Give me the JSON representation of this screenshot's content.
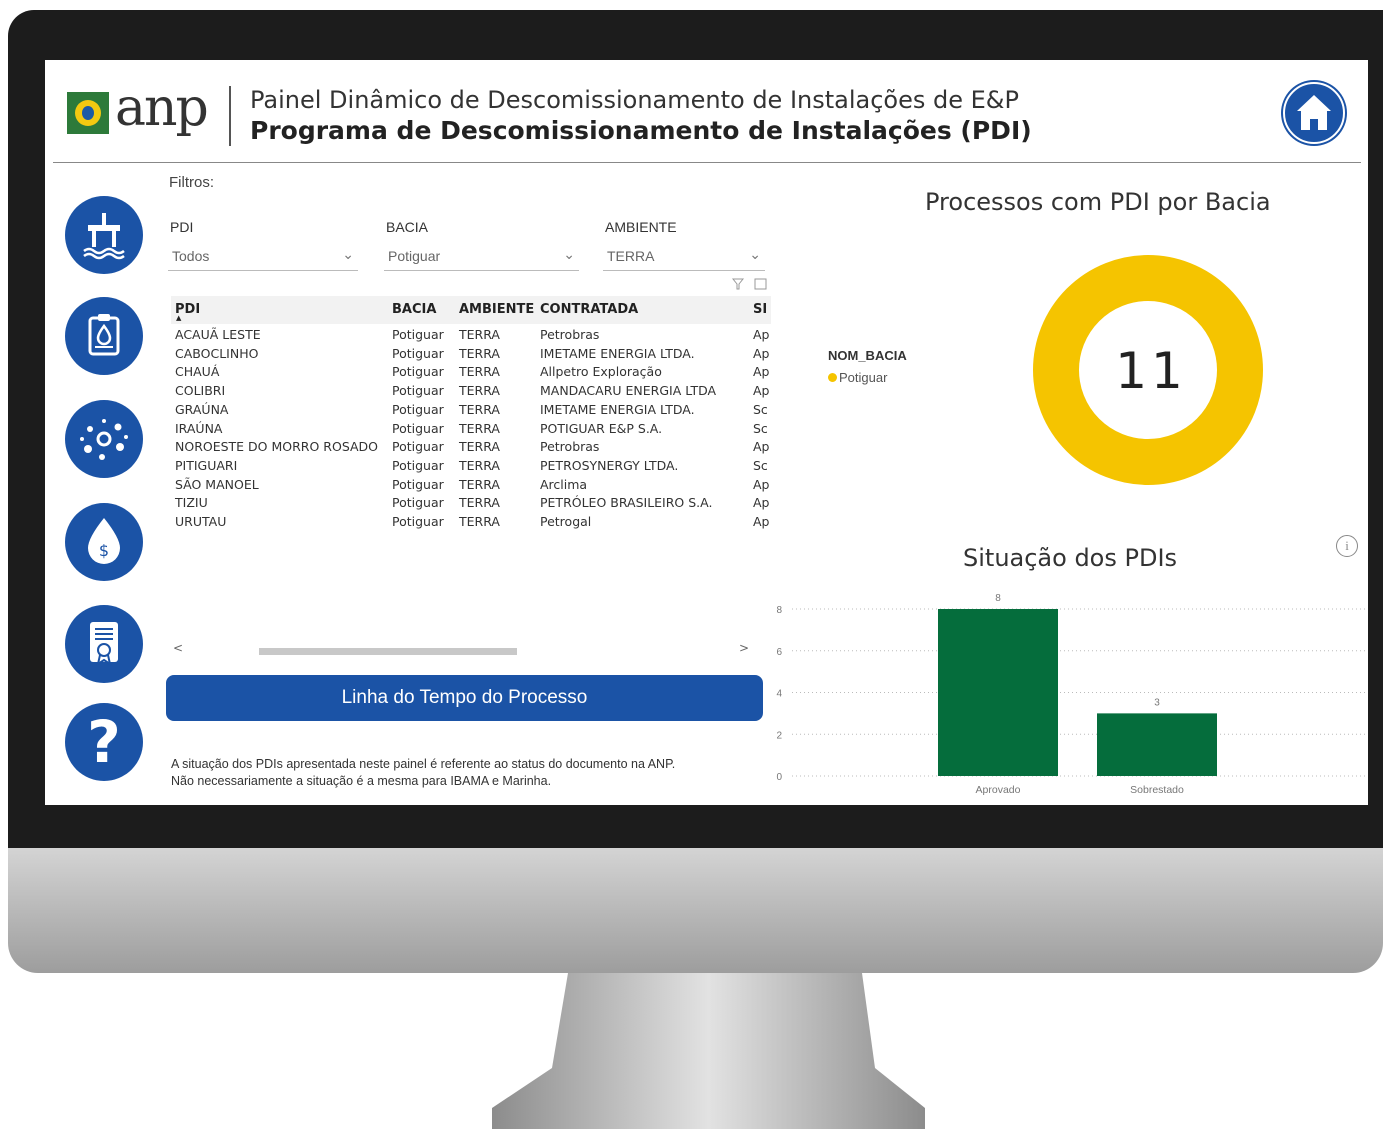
{
  "header": {
    "logo_text": "anp",
    "subtitle": "Painel Dinâmico de Descomissionamento de Instalações de E&P",
    "title": "Programa de Descomissionamento de Instalações (PDI)"
  },
  "nav": {
    "icons": [
      "platform-icon",
      "clipboard-drop-icon",
      "particles-icon",
      "money-drop-icon",
      "certificate-icon",
      "question-icon"
    ],
    "help_glyph": "?"
  },
  "filters": {
    "label": "Filtros:",
    "pdi": {
      "label": "PDI",
      "value": "Todos"
    },
    "bacia": {
      "label": "BACIA",
      "value": "Potiguar"
    },
    "ambiente": {
      "label": "AMBIENTE",
      "value": "TERRA"
    }
  },
  "table": {
    "headers": {
      "pdi": "PDI",
      "bacia": "BACIA",
      "ambiente": "AMBIENTE",
      "contratada": "CONTRATADA",
      "situacao": "SI"
    },
    "rows": [
      {
        "pdi": "ACAUÃ LESTE",
        "bacia": "Potiguar",
        "ambiente": "TERRA",
        "contratada": "Petrobras",
        "situacao": "Ap"
      },
      {
        "pdi": "CABOCLINHO",
        "bacia": "Potiguar",
        "ambiente": "TERRA",
        "contratada": "IMETAME ENERGIA LTDA.",
        "situacao": "Ap"
      },
      {
        "pdi": "CHAUÁ",
        "bacia": "Potiguar",
        "ambiente": "TERRA",
        "contratada": "Allpetro Exploração",
        "situacao": "Ap"
      },
      {
        "pdi": "COLIBRI",
        "bacia": "Potiguar",
        "ambiente": "TERRA",
        "contratada": "MANDACARU ENERGIA LTDA",
        "situacao": "Ap"
      },
      {
        "pdi": "GRAÚNA",
        "bacia": "Potiguar",
        "ambiente": "TERRA",
        "contratada": "IMETAME ENERGIA LTDA.",
        "situacao": "Sc"
      },
      {
        "pdi": "IRAÚNA",
        "bacia": "Potiguar",
        "ambiente": "TERRA",
        "contratada": "POTIGUAR E&P S.A.",
        "situacao": "Sc"
      },
      {
        "pdi": "NOROESTE DO MORRO ROSADO",
        "bacia": "Potiguar",
        "ambiente": "TERRA",
        "contratada": "Petrobras",
        "situacao": "Ap"
      },
      {
        "pdi": "PITIGUARI",
        "bacia": "Potiguar",
        "ambiente": "TERRA",
        "contratada": "PETROSYNERGY LTDA.",
        "situacao": "Sc"
      },
      {
        "pdi": "SÃO MANOEL",
        "bacia": "Potiguar",
        "ambiente": "TERRA",
        "contratada": "Arclima",
        "situacao": "Ap"
      },
      {
        "pdi": "TIZIU",
        "bacia": "Potiguar",
        "ambiente": "TERRA",
        "contratada": "PETRÓLEO BRASILEIRO S.A.",
        "situacao": "Ap"
      },
      {
        "pdi": "URUTAU",
        "bacia": "Potiguar",
        "ambiente": "TERRA",
        "contratada": "Petrogal",
        "situacao": "Ap"
      }
    ]
  },
  "timeline_button": "Linha do Tempo do Processo",
  "note": {
    "line1": "A situação dos PDIs apresentada neste painel é referente ao status do documento na ANP.",
    "line2": "Não necessariamente a situação é a mesma para IBAMA e Marinha."
  },
  "donut": {
    "title": "Processos com PDI por Bacia",
    "legend_title": "NOM_BACIA",
    "legend_item": "Potiguar",
    "center_value": "11",
    "color": "#f5c400"
  },
  "bar": {
    "title": "Situação dos PDIs",
    "color": "#056d3c"
  },
  "chart_data": [
    {
      "type": "pie",
      "title": "Processos com PDI por Bacia",
      "categories": [
        "Potiguar"
      ],
      "values": [
        11
      ],
      "legend_title": "NOM_BACIA",
      "legend_position": "left"
    },
    {
      "type": "bar",
      "title": "Situação dos PDIs",
      "categories": [
        "Aprovado",
        "Sobrestado"
      ],
      "values": [
        8,
        3
      ],
      "data_labels": [
        "8",
        "3"
      ],
      "yticks": [
        0,
        2,
        4,
        6,
        8
      ],
      "ylim": [
        0,
        8
      ],
      "grid": true
    }
  ]
}
